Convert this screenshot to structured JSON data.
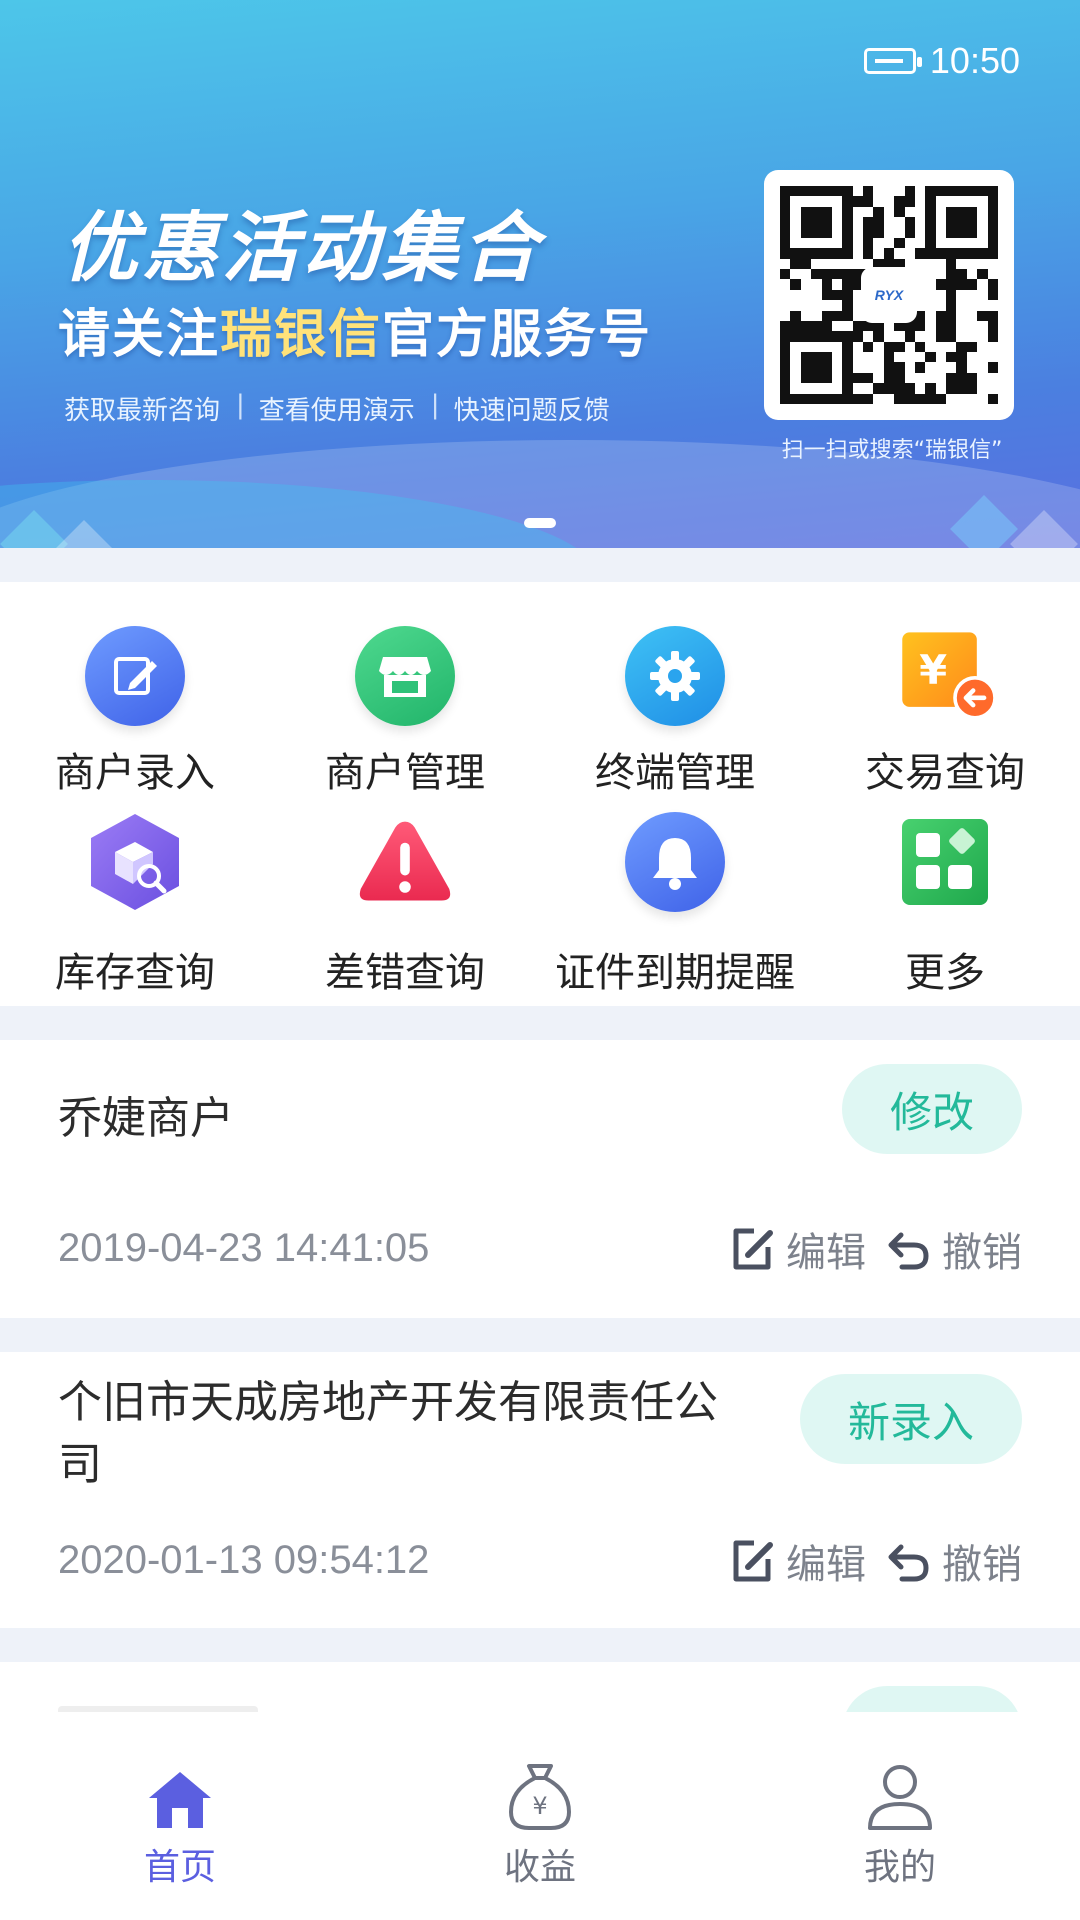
{
  "status_bar": {
    "time": "10:50"
  },
  "banner": {
    "title": "优惠活动集合",
    "subtitle_prefix": "请关注",
    "subtitle_highlight": "瑞银信",
    "subtitle_suffix": "官方服务号",
    "tags": [
      "获取最新咨询",
      "查看使用演示",
      "快速问题反馈"
    ],
    "qr_logo": "RYX",
    "qr_caption": "扫一扫或搜索“瑞银信”"
  },
  "menu": {
    "items": [
      {
        "label": "商户录入",
        "icon": "edit-icon"
      },
      {
        "label": "商户管理",
        "icon": "store-icon"
      },
      {
        "label": "终端管理",
        "icon": "gear-icon"
      },
      {
        "label": "交易查询",
        "icon": "yuan-exchange-icon"
      },
      {
        "label": "库存查询",
        "icon": "inventory-search-icon"
      },
      {
        "label": "差错查询",
        "icon": "warning-icon"
      },
      {
        "label": "证件到期提醒",
        "icon": "bell-icon"
      },
      {
        "label": "更多",
        "icon": "grid-icon"
      }
    ]
  },
  "records": [
    {
      "name": "乔婕商户",
      "status": "修改",
      "time": "2019-04-23 14:41:05",
      "edit": "编辑",
      "revoke": "撤销"
    },
    {
      "name_line1": "个旧市天成房地产开发有限责任公",
      "name_line2": "司",
      "status": "新录入",
      "time": "2020-01-13 09:54:12",
      "edit": "编辑",
      "revoke": "撤销"
    }
  ],
  "tabbar": {
    "items": [
      {
        "label": "首页",
        "icon": "home-icon",
        "active": true
      },
      {
        "label": "收益",
        "icon": "money-bag-icon",
        "active": false
      },
      {
        "label": "我的",
        "icon": "user-icon",
        "active": false
      }
    ],
    "active_color": "#5b5fe0",
    "inactive_color": "#6e7380"
  },
  "colors": {
    "accent_teal": "#23b99a",
    "pill_bg": "#dff7f3",
    "band": "#eef2f9"
  }
}
